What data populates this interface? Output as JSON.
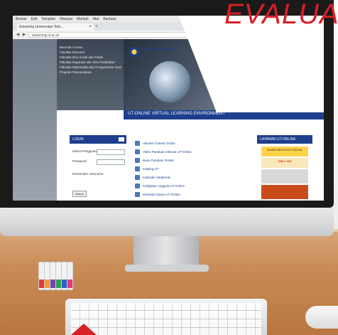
{
  "banner": {
    "title": "EVALUA"
  },
  "browser": {
    "menu": [
      "Berkas",
      "Edit",
      "Tampilan",
      "Riwayat",
      "Markah",
      "Alat",
      "Bantuan"
    ],
    "tab_title": "Elearning Universitas Terb...",
    "tab_close": "×",
    "new_tab": "+",
    "back": "◀",
    "forward": "▶",
    "url": "elearning.ut.ac.id"
  },
  "site": {
    "logo_text": "Universitas Terbuka",
    "side_menu": [
      "Beranda / Home",
      "Fakultas Ekonomi",
      "Fakultas Ilmu Sosial dan Politik",
      "Fakultas Keguruan dan Ilmu Pendidikan",
      "Fakultas Matematika dan Pengetahuan Alam",
      "Program Pascasarjana"
    ],
    "band_title": "UT-ONLINE VIRTUAL LEARNING ENVIRONMENT",
    "login": {
      "header": "LOGIN",
      "username_label": "Nama Pengguna",
      "password_label": "Password",
      "remember_label": "Remember username",
      "button": "Masuk"
    },
    "links": [
      "Aktivasi Tutorial Online",
      "Video Panduan Aktivasi UT-Online",
      "Buku Panduan Online",
      "Katalog UT",
      "Kalender Akademik",
      "Kebijakan Anggota UT-Online",
      "Panduan Dasar UT-Online"
    ],
    "right_panel": {
      "header": "LAYANAN UT-ONLINE",
      "promo1": "SUARA SEKOLAH DIGITAL",
      "promo2": "Office 365",
      "promo3": "",
      "promo4": ""
    }
  },
  "colors": {
    "accent_red": "#d81f26",
    "ut_blue": "#1d3f8e"
  }
}
